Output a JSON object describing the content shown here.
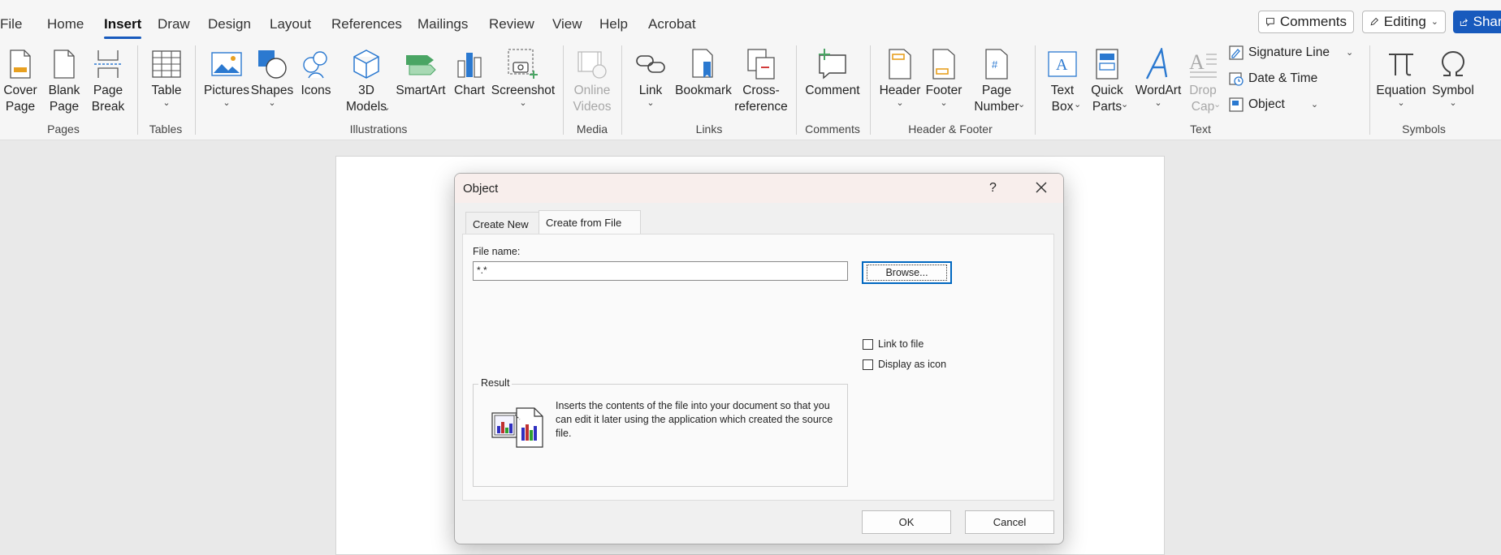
{
  "menu": {
    "tabs": [
      "File",
      "Home",
      "Insert",
      "Draw",
      "Design",
      "Layout",
      "References",
      "Mailings",
      "Review",
      "View",
      "Help",
      "Acrobat"
    ],
    "active_tab": "Insert",
    "comments_label": "Comments",
    "editing_label": "Editing",
    "share_label": "Share"
  },
  "ribbon": {
    "pages": {
      "cover": "Cover\nPage",
      "blank": "Blank\nPage",
      "break": "Page\nBreak",
      "group": "Pages"
    },
    "tables": {
      "table": "Table",
      "group": "Tables"
    },
    "illustrations": {
      "pictures": "Pictures",
      "shapes": "Shapes",
      "icons": "Icons",
      "models": "3D\nModels",
      "smartart": "SmartArt",
      "chart": "Chart",
      "screenshot": "Screenshot",
      "group": "Illustrations"
    },
    "media": {
      "online_videos": "Online\nVideos",
      "group": "Media"
    },
    "links": {
      "link": "Link",
      "bookmark": "Bookmark",
      "cross_reference": "Cross-\nreference",
      "group": "Links"
    },
    "comments": {
      "comment": "Comment",
      "group": "Comments"
    },
    "header_footer": {
      "header": "Header",
      "footer": "Footer",
      "page_number": "Page\nNumber",
      "group": "Header & Footer"
    },
    "text": {
      "text_box": "Text\nBox",
      "quick_parts": "Quick\nParts",
      "wordart": "WordArt",
      "drop_cap": "Drop\nCap",
      "signature_line": "Signature Line",
      "date_time": "Date & Time",
      "object": "Object",
      "group": "Text"
    },
    "symbols": {
      "equation": "Equation",
      "symbol": "Symbol",
      "group": "Symbols"
    }
  },
  "dialog": {
    "title": "Object",
    "help": "?",
    "tabs": {
      "create_new": "Create New",
      "create_from_file": "Create from File"
    },
    "file_name_label": "File name:",
    "file_name_value": "*.*",
    "browse_label": "Browse...",
    "link_to_file": "Link to file",
    "display_as_icon": "Display as icon",
    "result_label": "Result",
    "result_text": "Inserts the contents of the file into your document so that you can edit it later using the application which created the source file.",
    "ok_label": "OK",
    "cancel_label": "Cancel"
  }
}
